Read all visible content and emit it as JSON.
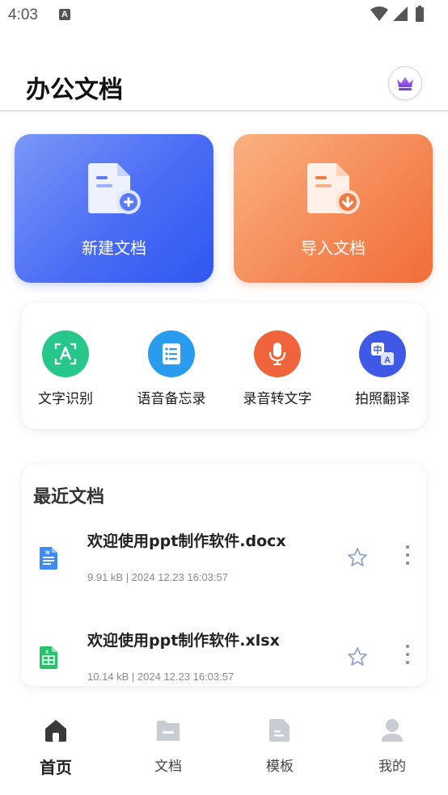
{
  "status_bar": {
    "time": "4:03",
    "notification_glyph": "A"
  },
  "header": {
    "title": "办公文档",
    "vip_icon": "crown-icon"
  },
  "actions": {
    "new_doc": {
      "label": "新建文档",
      "icon": "new-document-icon",
      "color": "#4a6cf5"
    },
    "import_doc": {
      "label": "导入文档",
      "icon": "import-document-icon",
      "color": "#f58a57"
    }
  },
  "tools": [
    {
      "label": "文字识别",
      "icon": "text-recognition-icon",
      "color": "#27c68a"
    },
    {
      "label": "语音备忘录",
      "icon": "voice-memo-icon",
      "color": "#2a9cf0"
    },
    {
      "label": "录音转文字",
      "icon": "microphone-icon",
      "color": "#f0643c"
    },
    {
      "label": "拍照翻译",
      "icon": "translate-icon",
      "color": "#3f58e6"
    }
  ],
  "recent": {
    "title": "最近文档",
    "files": [
      {
        "name": "欢迎使用ppt制作软件.docx",
        "meta": "9.91 kB | 2024 12.23 16:03:57",
        "icon": "word-file-icon"
      },
      {
        "name": "欢迎使用ppt制作软件.xlsx",
        "meta": "10.14 kB | 2024 12.23 16:03:57",
        "icon": "excel-file-icon"
      }
    ]
  },
  "tabs": [
    {
      "label": "首页",
      "icon": "home-icon",
      "active": true
    },
    {
      "label": "文档",
      "icon": "folder-icon",
      "active": false
    },
    {
      "label": "模板",
      "icon": "template-icon",
      "active": false
    },
    {
      "label": "我的",
      "icon": "user-icon",
      "active": false
    }
  ]
}
